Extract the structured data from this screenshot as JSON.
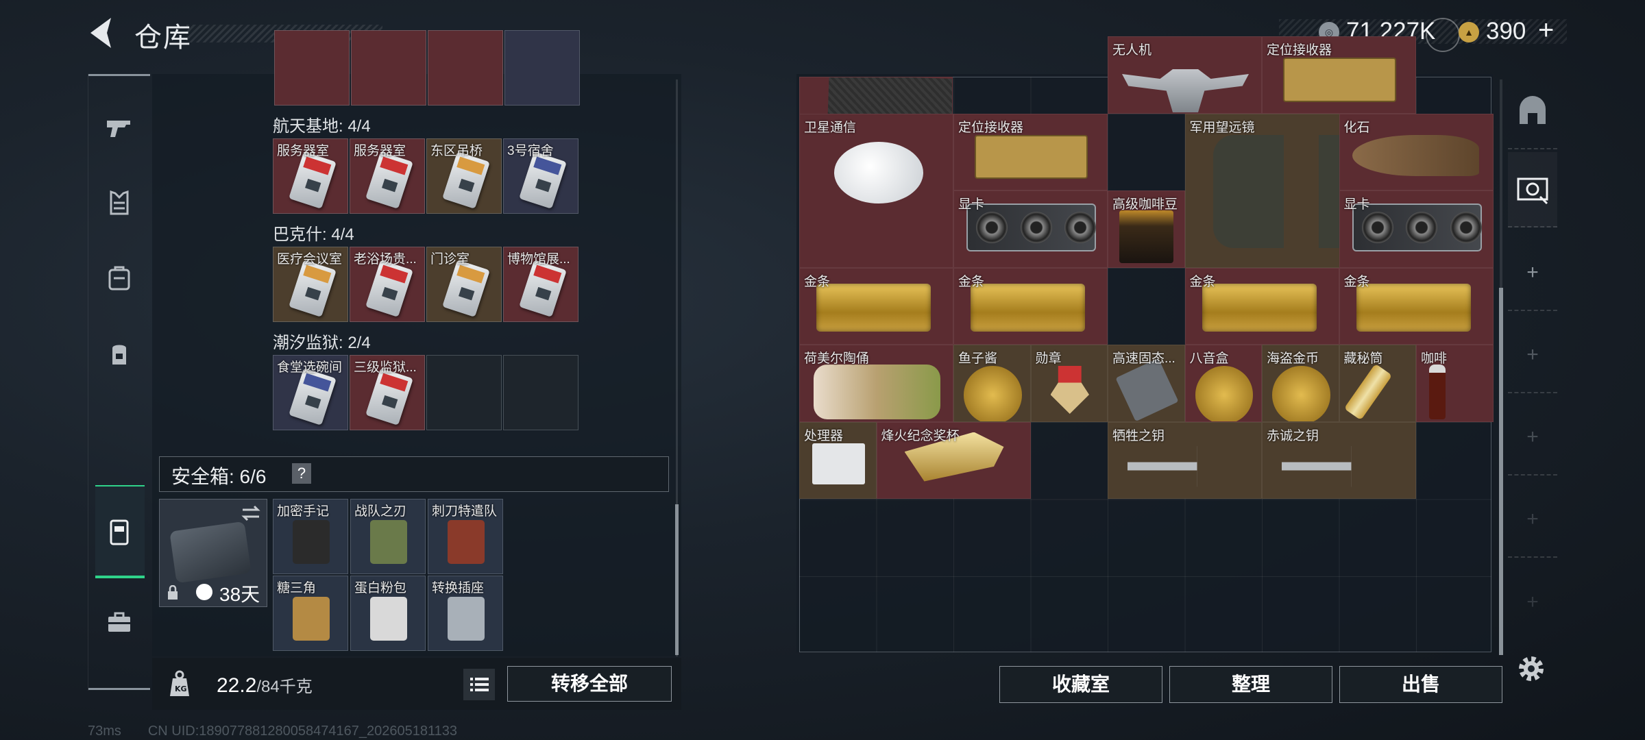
{
  "header": {
    "title": "仓库"
  },
  "currency": {
    "coins": "71,227K",
    "premium": "390",
    "plus": "+"
  },
  "left_nav": [
    "gun-icon",
    "armor-icon",
    "backpack-icon",
    "vest-icon",
    "keycard-icon",
    "toolbox-icon"
  ],
  "key_groups": [
    {
      "title": "航天基地: 4/4",
      "slots": [
        {
          "label": "服务器室",
          "color": "red"
        },
        {
          "label": "服务器室",
          "color": "red"
        },
        {
          "label": "东区吊桥",
          "color": "olive"
        },
        {
          "label": "3号宿舍",
          "color": "navy"
        }
      ]
    },
    {
      "title": "巴克什: 4/4",
      "slots": [
        {
          "label": "医疗会议室",
          "color": "olive"
        },
        {
          "label": "老浴场贵...",
          "color": "red"
        },
        {
          "label": "门诊室",
          "color": "olive"
        },
        {
          "label": "博物馆展...",
          "color": "red"
        }
      ]
    },
    {
      "title": "潮汐监狱: 2/4",
      "slots": [
        {
          "label": "食堂选碗间",
          "color": "navy"
        },
        {
          "label": "三级监狱...",
          "color": "red"
        },
        {
          "label": "",
          "color": "empty"
        },
        {
          "label": "",
          "color": "empty"
        }
      ]
    }
  ],
  "safe": {
    "title": "安全箱: 6/6",
    "help": "?",
    "days": "38天",
    "slots": [
      "加密手记",
      "战队之刃",
      "刺刀特遣队",
      "糖三角",
      "蛋白粉包",
      "转换插座"
    ]
  },
  "weight": {
    "value": "22.2",
    "unit": "/84千克"
  },
  "buttons": {
    "transfer_all": "转移全部",
    "collection": "收藏室",
    "sort": "整理",
    "sell": "出售"
  },
  "items": {
    "drone": "无人机",
    "locator1": "定位接收器",
    "satellite": "卫星通信",
    "locator2": "定位接收器",
    "binocular": "军用望远镜",
    "fossil": "化石",
    "gpu1": "显卡",
    "coffee": "高级咖啡豆",
    "gpu2": "显卡",
    "gold1": "金条",
    "gold2": "金条",
    "gold3": "金条",
    "gold4": "金条",
    "porcelain": "荷美尔陶俑",
    "caviar": "鱼子酱",
    "medal": "勋章",
    "ssd": "高速固态...",
    "musicbox": "八音盒",
    "piratecoin": "海盗金币",
    "scroll": "藏秘筒",
    "cola": "咖啡",
    "processor": "处理器",
    "trophy": "烽火纪念奖杯",
    "key1": "牺牲之钥",
    "key2": "赤诚之钥"
  },
  "status": {
    "ping": "73ms",
    "uid": "CN UID:189077881280058474167_202605181133"
  },
  "colors": {
    "accent": "#2fd38a",
    "item_red": "#5b2c31",
    "item_olive": "#4c3e2d",
    "item_navy": "#303448"
  }
}
